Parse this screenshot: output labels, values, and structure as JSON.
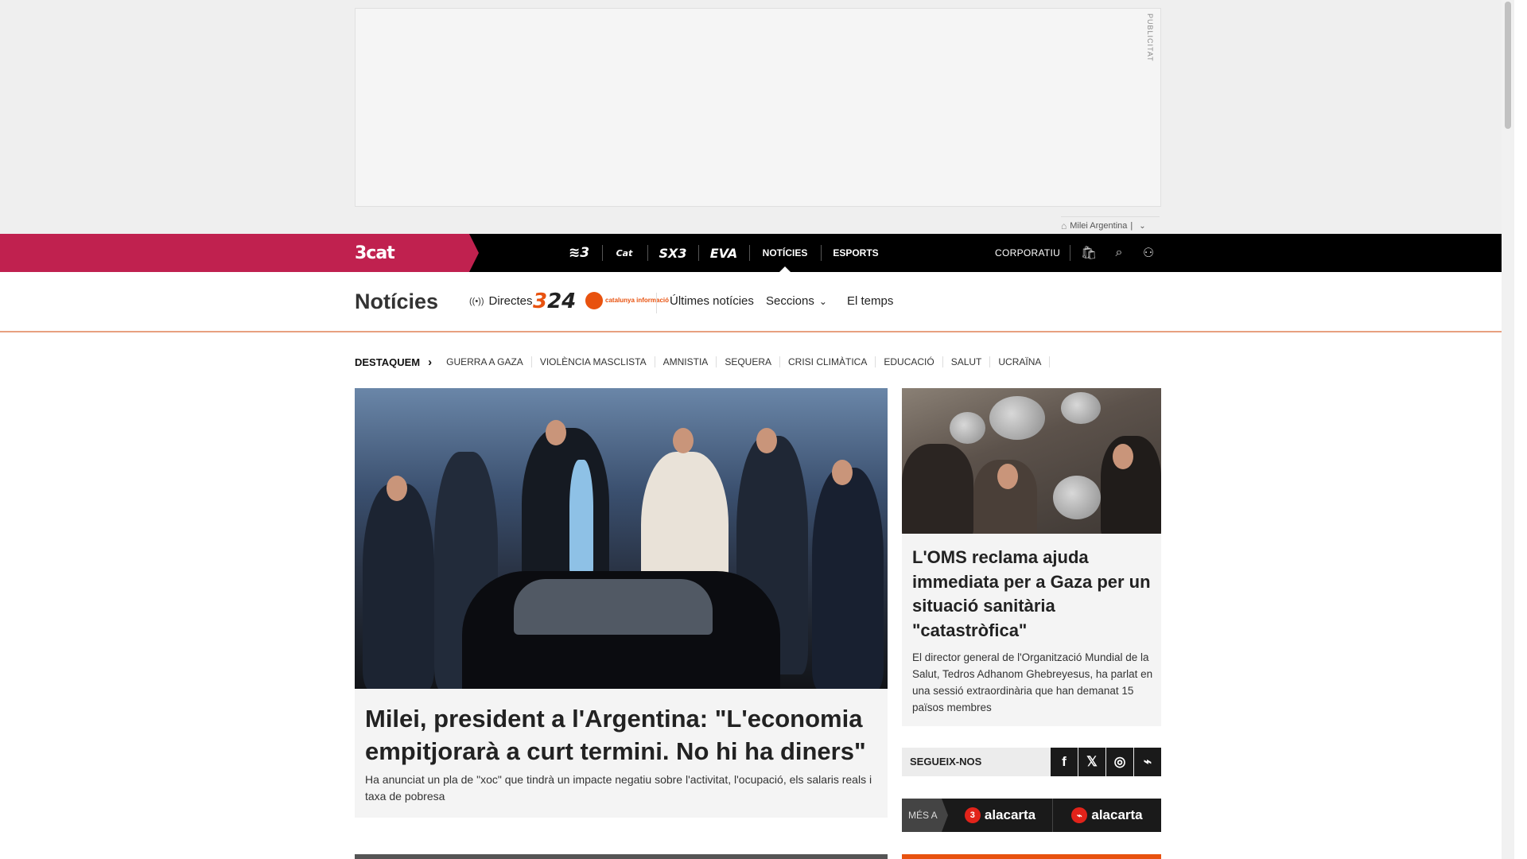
{
  "ad": {
    "label": "PUBLICITAT",
    "tag": "Milei Argentina"
  },
  "topnav": {
    "brand": "3cat",
    "channels": [
      {
        "label": "≋3",
        "name": "tv3"
      },
      {
        "label": "Cat",
        "name": "catradio"
      },
      {
        "label": "SX3",
        "name": "sx3"
      },
      {
        "label": "EVA",
        "name": "eva"
      }
    ],
    "noticies": "NOTÍCIES",
    "esports": "ESPORTS",
    "corporatiu": "CORPORATIU"
  },
  "section": {
    "title": "Notícies",
    "directes": "Directes",
    "logo324": "324",
    "logo_ci": "catalunya informació",
    "ultimes": "Últimes notícies",
    "seccions": "Seccions",
    "temps": "El temps"
  },
  "highlights": {
    "title": "DESTAQUEM",
    "items": [
      "GUERRA A GAZA",
      "VIOLÈNCIA MASCLISTA",
      "AMNISTIA",
      "SEQUERA",
      "CRISI CLIMÀTICA",
      "EDUCACIÓ",
      "SALUT",
      "UCRAÏNA"
    ]
  },
  "main_story": {
    "title": "Milei, president a l'Argentina: \"L'economia empitjorarà a curt termini. No hi ha diners\"",
    "subtitle": "Ha anunciat un pla de \"xoc\" que tindrà un impacte negatiu sobre l'activitat, l'ocupació, els salaris reals i taxa de pobresa"
  },
  "side_story": {
    "title": "L'OMS reclama ajuda immediata per a Gaza per un situació sanitària \"catastròfica\"",
    "subtitle": "El director general de l'Organització Mundial de la Salut, Tedros Adhanom Ghebreyesus, ha parlat en una sessió extraordinària que han demanat 15 països membres"
  },
  "follow": {
    "label": "SEGUEIX-NOS",
    "icons": [
      "f",
      "𝕏",
      "◎",
      "⌁"
    ]
  },
  "more": {
    "label": "MÉS A",
    "btn1": "alacarta",
    "btn2": "alacarta"
  }
}
